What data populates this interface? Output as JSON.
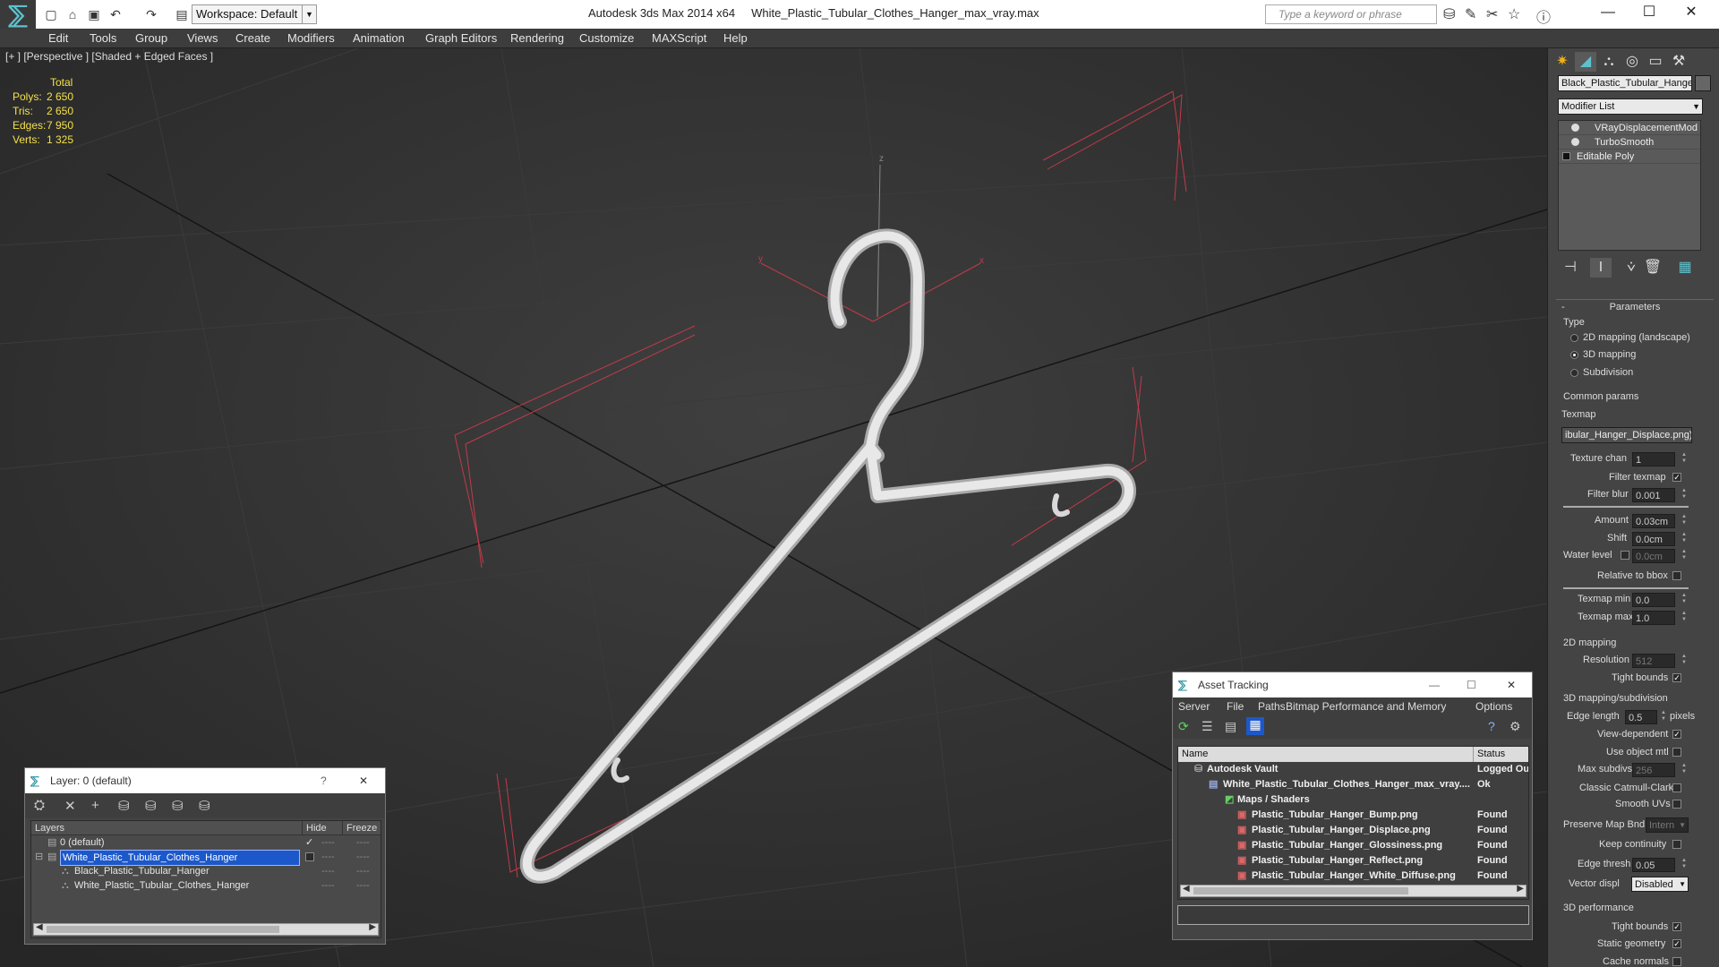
{
  "app": {
    "title": "Autodesk 3ds Max  2014 x64",
    "file": "White_Plastic_Tubular_Clothes_Hanger_max_vray.max",
    "workspace": "Workspace: Default",
    "search_placeholder": "Type a keyword or phrase"
  },
  "menu": [
    "Edit",
    "Tools",
    "Group",
    "Views",
    "Create",
    "Modifiers",
    "Animation",
    "Graph Editors",
    "Rendering",
    "Customize",
    "MAXScript",
    "Help"
  ],
  "viewport": {
    "label": "[+ ] [Perspective ] [Shaded + Edged Faces ]",
    "stats_header": "Total",
    "stats": [
      {
        "k": "Polys:",
        "v": "2 650"
      },
      {
        "k": "Tris:",
        "v": "2 650"
      },
      {
        "k": "Edges:",
        "v": "7 950"
      },
      {
        "k": "Verts:",
        "v": "1 325"
      }
    ],
    "axis": {
      "x": "x",
      "y": "y",
      "z": "z"
    }
  },
  "command_panel": {
    "object_name": "Black_Plastic_Tubular_Hanger",
    "modifier_list": "Modifier List",
    "stack": [
      "VRayDisplacementMod",
      "TurboSmooth",
      "Editable Poly"
    ],
    "parameters": "Parameters",
    "type_label": "Type",
    "type_options": [
      "2D mapping (landscape)",
      "3D mapping",
      "Subdivision"
    ],
    "common_params": "Common params",
    "texmap_label": "Texmap",
    "texmap_value": "ibular_Hanger_Displace.png)",
    "texture_chan_label": "Texture chan",
    "texture_chan": "1",
    "filter_texmap": "Filter texmap",
    "filter_blur_label": "Filter blur",
    "filter_blur": "0.001",
    "amount_label": "Amount",
    "amount": "0.03cm",
    "shift_label": "Shift",
    "shift": "0.0cm",
    "water_level_label": "Water level",
    "water_level": "0.0cm",
    "relative_bbox": "Relative to bbox",
    "texmap_min_label": "Texmap min",
    "texmap_min": "0.0",
    "texmap_max_label": "Texmap max",
    "texmap_max": "1.0",
    "mapping_2d": "2D mapping",
    "resolution_label": "Resolution",
    "resolution": "512",
    "tight_bounds": "Tight bounds",
    "mapping_3d": "3D mapping/subdivision",
    "edge_length_label": "Edge length",
    "edge_length": "0.5",
    "pixels": "pixels",
    "view_dependent": "View-dependent",
    "use_object_mtl": "Use object mtl",
    "max_subdivs_label": "Max subdivs",
    "max_subdivs": "256",
    "classic_catmull": "Classic Catmull-Clark",
    "smooth_uvs": "Smooth UVs",
    "preserve_map_bnd": "Preserve Map Bnd",
    "preserve_map_val": "Intern",
    "keep_continuity": "Keep continuity",
    "edge_thresh_label": "Edge thresh",
    "edge_thresh": "0.05",
    "vector_displ_label": "Vector displ",
    "vector_displ": "Disabled",
    "perf": "3D performance",
    "tight_bounds2": "Tight bounds",
    "static_geometry": "Static geometry",
    "cache_normals": "Cache normals"
  },
  "layer_window": {
    "title": "Layer: 0 (default)",
    "help": "?",
    "close": "✕",
    "cols": {
      "layers": "Layers",
      "hide": "Hide",
      "freeze": "Freeze"
    },
    "rows": [
      {
        "name": "0 (default)",
        "check": "✓"
      },
      {
        "name": "White_Plastic_Tubular_Clothes_Hanger",
        "check": ""
      },
      {
        "name": "Black_Plastic_Tubular_Hanger",
        "check": ""
      },
      {
        "name": "White_Plastic_Tubular_Clothes_Hanger",
        "check": ""
      }
    ],
    "dash": "----"
  },
  "asset_window": {
    "title": "Asset Tracking",
    "menu": [
      "Server",
      "File",
      "Paths",
      "Bitmap Performance and Memory",
      "Options"
    ],
    "cols": {
      "name": "Name",
      "status": "Status"
    },
    "rows": [
      {
        "name": "Autodesk Vault",
        "status": "Logged Ou"
      },
      {
        "name": "White_Plastic_Tubular_Clothes_Hanger_max_vray....",
        "status": "Ok"
      },
      {
        "name": "Maps / Shaders",
        "status": ""
      },
      {
        "name": "Plastic_Tubular_Hanger_Bump.png",
        "status": "Found"
      },
      {
        "name": "Plastic_Tubular_Hanger_Displace.png",
        "status": "Found"
      },
      {
        "name": "Plastic_Tubular_Hanger_Glossiness.png",
        "status": "Found"
      },
      {
        "name": "Plastic_Tubular_Hanger_Reflect.png",
        "status": "Found"
      },
      {
        "name": "Plastic_Tubular_Hanger_White_Diffuse.png",
        "status": "Found"
      }
    ],
    "close": "✕"
  }
}
